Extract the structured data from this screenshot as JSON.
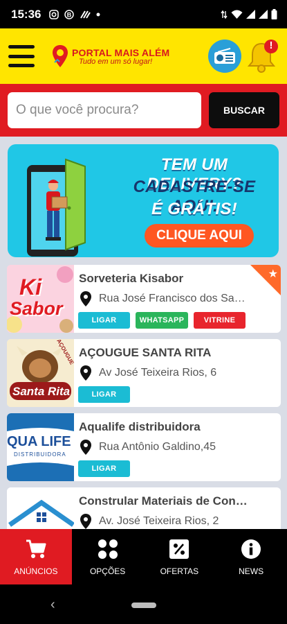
{
  "status_bar": {
    "time": "15:36",
    "left_icons": [
      "instagram-icon",
      "b-badge-icon",
      "stripe-icon",
      "dot-icon"
    ],
    "right_icons": [
      "data-arrows-icon",
      "wifi-icon",
      "signal-icon",
      "signal-icon",
      "battery-icon"
    ]
  },
  "header": {
    "logo_name": "PORTAL MAIS ALÉM",
    "logo_tagline": "Tudo em um só lugar!",
    "notification_badge": "!"
  },
  "search": {
    "placeholder": "O que você procura?",
    "button_label": "BUSCAR"
  },
  "banner": {
    "line1": "TEM UM DELIVERY?",
    "line2": "CADASTRE-SE AQUI.",
    "line3": "É GRÁTIS!",
    "cta": "CLIQUE AQUI"
  },
  "listings": [
    {
      "title": "Sorveteria Kisabor",
      "address": "Rua José Francisco dos Santos",
      "thumb_line1": "Ki",
      "thumb_line2": "Sabor",
      "featured": true,
      "buttons": [
        "LIGAR",
        "WHATSAPP",
        "VITRINE"
      ]
    },
    {
      "title": "AÇOUGUE SANTA RITA",
      "address": "Av José Teixeira Rios, 6",
      "thumb_top": "AÇOUGUE",
      "thumb_bottom": "Santa Rita",
      "buttons": [
        "LIGAR"
      ]
    },
    {
      "title": "Aqualife distribuidora",
      "address": "Rua Antônio Galdino,45",
      "thumb_line1": "QUA LIFE",
      "thumb_line2": "DISTRIBUIDORA",
      "buttons": [
        "LIGAR"
      ]
    },
    {
      "title": "Constrular Materiais de Construção",
      "address": "Av. José Teixeira Rios, 2"
    }
  ],
  "bottom_nav": [
    {
      "label": "ANÚNCIOS",
      "icon": "cart-icon",
      "active": true
    },
    {
      "label": "OPÇÕES",
      "icon": "grid-dots-icon"
    },
    {
      "label": "OFERTAS",
      "icon": "percent-icon"
    },
    {
      "label": "NEWS",
      "icon": "info-icon"
    }
  ],
  "colors": {
    "header_yellow": "#ffe500",
    "brand_red": "#e01b22",
    "ligar_cyan": "#1bbcd4",
    "whatsapp_green": "#2ab55b",
    "vitrine_red": "#e8252d",
    "banner_cyan": "#20c7e6"
  }
}
